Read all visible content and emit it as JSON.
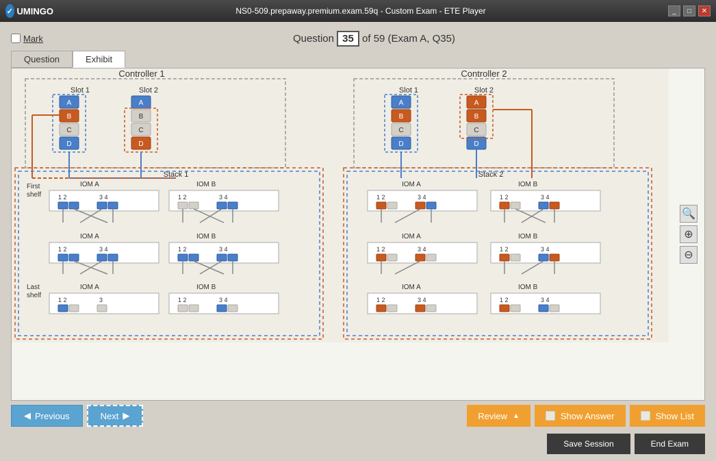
{
  "titleBar": {
    "title": "NS0-509.prepaway.premium.exam.59q - Custom Exam - ETE Player",
    "logo": "UMINGO",
    "controls": {
      "minimize": "_",
      "restore": "□",
      "close": "✕"
    }
  },
  "topBar": {
    "markLabel": "Mark",
    "questionInfo": "Question",
    "questionNumber": "35",
    "ofText": "of 59 (Exam A, Q35)"
  },
  "tabs": {
    "question": "Question",
    "exhibit": "Exhibit",
    "activeTab": "exhibit"
  },
  "zoomControls": {
    "zoomIn": "+",
    "zoomOut": "-",
    "zoomReset": "🔍"
  },
  "bottomToolbar": {
    "previousLabel": "Previous",
    "nextLabel": "Next",
    "reviewLabel": "Review",
    "showAnswerLabel": "Show Answer",
    "showListLabel": "Show List"
  },
  "saveEndRow": {
    "saveLabel": "Save Session",
    "endLabel": "End Exam"
  },
  "diagram": {
    "controller1": "Controller 1",
    "controller2": "Controller 2",
    "slot1": "Slot 1",
    "slot2": "Slot 2",
    "stack1": "Stack 1",
    "stack2": "Stack 2",
    "iomA": "IOM A",
    "iomB": "IOM B",
    "firstShelf": "First shelf",
    "lastShelf": "Last shelf"
  }
}
